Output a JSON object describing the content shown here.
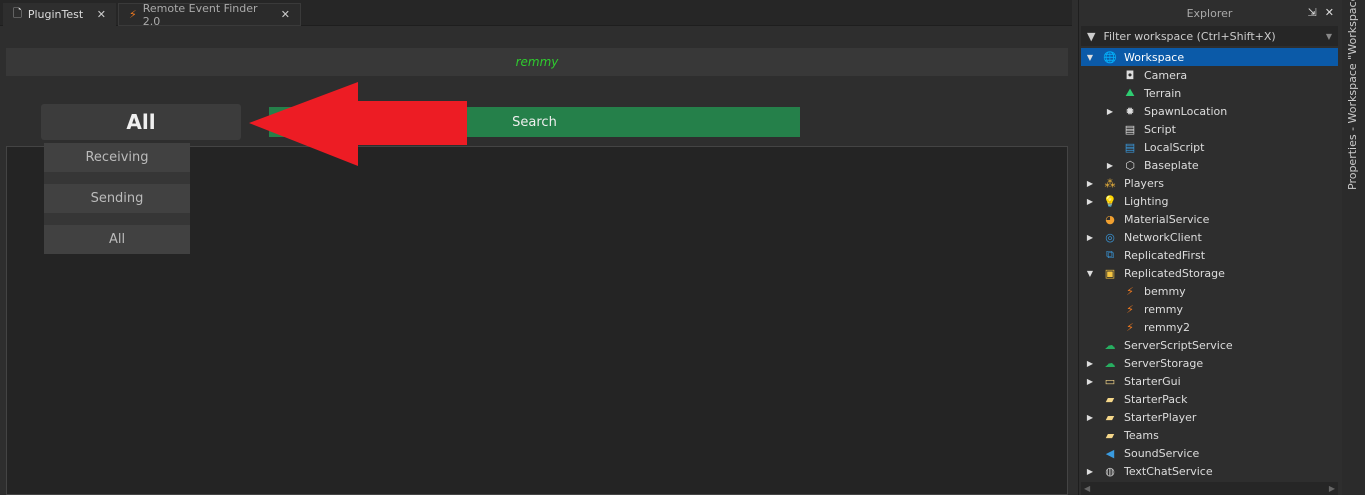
{
  "tabs": [
    {
      "label": "PluginTest",
      "icon": "plugin-file-icon",
      "active": true
    },
    {
      "label": "Remote Event Finder 2.0",
      "icon": "lightning-icon",
      "active": false
    }
  ],
  "plugin": {
    "query": "remmy",
    "mode": "All",
    "search_label": "Search",
    "options": [
      "Receiving",
      "Sending",
      "All"
    ],
    "accent": "#25804a",
    "arrow_color": "#ed1c24"
  },
  "explorer": {
    "title": "Explorer",
    "filter_placeholder": "Filter workspace (Ctrl+Shift+X)",
    "items": [
      {
        "label": "Workspace",
        "level": 0,
        "expand": "open",
        "icon": "globe-icon",
        "color": "#fff",
        "selected": true
      },
      {
        "label": "Camera",
        "level": 1,
        "expand": "",
        "icon": "camera-icon",
        "color": "#ddd"
      },
      {
        "label": "Terrain",
        "level": 1,
        "expand": "",
        "icon": "terrain-icon",
        "color": "#2ecc71"
      },
      {
        "label": "SpawnLocation",
        "level": 1,
        "expand": "closed",
        "icon": "spawn-icon",
        "color": "#ddd"
      },
      {
        "label": "Script",
        "level": 1,
        "expand": "",
        "icon": "script-icon",
        "color": "#ddd"
      },
      {
        "label": "LocalScript",
        "level": 1,
        "expand": "",
        "icon": "localscript-icon",
        "color": "#3a9be0"
      },
      {
        "label": "Baseplate",
        "level": 1,
        "expand": "closed",
        "icon": "part-icon",
        "color": "#ddd"
      },
      {
        "label": "Players",
        "level": 0,
        "expand": "closed",
        "icon": "players-icon",
        "color": "#f5b93c"
      },
      {
        "label": "Lighting",
        "level": 0,
        "expand": "closed",
        "icon": "lightbulb-icon",
        "color": "#f5d142"
      },
      {
        "label": "MaterialService",
        "level": 0,
        "expand": "",
        "icon": "material-icon",
        "color": "#f0a030"
      },
      {
        "label": "NetworkClient",
        "level": 0,
        "expand": "closed",
        "icon": "network-icon",
        "color": "#3a9be0"
      },
      {
        "label": "ReplicatedFirst",
        "level": 0,
        "expand": "",
        "icon": "replicated-first-icon",
        "color": "#3a9be0"
      },
      {
        "label": "ReplicatedStorage",
        "level": 0,
        "expand": "open",
        "icon": "replicated-storage-icon",
        "color": "#f5c542"
      },
      {
        "label": "bemmy",
        "level": 1,
        "expand": "",
        "icon": "remote-event-icon",
        "color": "#f07a20"
      },
      {
        "label": "remmy",
        "level": 1,
        "expand": "",
        "icon": "remote-event-icon",
        "color": "#f07a20"
      },
      {
        "label": "remmy2",
        "level": 1,
        "expand": "",
        "icon": "remote-event-icon",
        "color": "#f07a20"
      },
      {
        "label": "ServerScriptService",
        "level": 0,
        "expand": "",
        "icon": "server-script-service-icon",
        "color": "#27ae60"
      },
      {
        "label": "ServerStorage",
        "level": 0,
        "expand": "closed",
        "icon": "server-storage-icon",
        "color": "#27ae60"
      },
      {
        "label": "StarterGui",
        "level": 0,
        "expand": "closed",
        "icon": "starter-gui-icon",
        "color": "#f5d78a"
      },
      {
        "label": "StarterPack",
        "level": 0,
        "expand": "",
        "icon": "starter-pack-icon",
        "color": "#f5d78a"
      },
      {
        "label": "StarterPlayer",
        "level": 0,
        "expand": "closed",
        "icon": "starter-player-icon",
        "color": "#f5d78a"
      },
      {
        "label": "Teams",
        "level": 0,
        "expand": "",
        "icon": "teams-icon",
        "color": "#f5d78a"
      },
      {
        "label": "SoundService",
        "level": 0,
        "expand": "",
        "icon": "sound-icon",
        "color": "#3a9be0"
      },
      {
        "label": "TextChatService",
        "level": 0,
        "expand": "closed",
        "icon": "chat-icon",
        "color": "#ccc"
      }
    ]
  },
  "side_panel": {
    "label": "Properties - Workspace \"Workspace\""
  }
}
